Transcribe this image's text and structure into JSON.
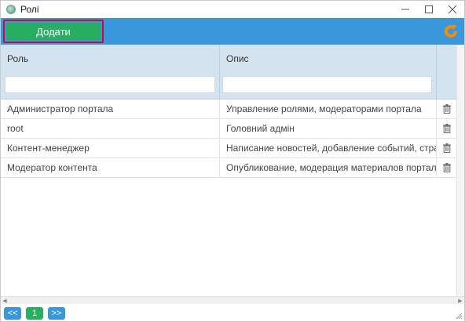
{
  "window": {
    "title": "Ролі"
  },
  "toolbar": {
    "add_label": "Додати"
  },
  "grid": {
    "columns": [
      "Роль",
      "Опис"
    ],
    "rows": [
      {
        "role": "Администратор портала",
        "description": "Управление ролями, модераторами портала"
      },
      {
        "role": "root",
        "description": "Головний адмін"
      },
      {
        "role": "Контент-менеджер",
        "description": "Написание новостей, добавление событий, страниц п"
      },
      {
        "role": "Модератор контента",
        "description": "Опубликование, модерация материалов портала"
      }
    ]
  },
  "pager": {
    "prev_label": "<<",
    "current_page": "1",
    "next_label": ">>"
  },
  "colors": {
    "toolbar": "#3a97dc",
    "add_button": "#27ae60",
    "header": "#d4e3f0",
    "refresh": "#f28c0f"
  },
  "icons": {
    "refresh": "refresh-icon",
    "delete": "trash-icon"
  }
}
